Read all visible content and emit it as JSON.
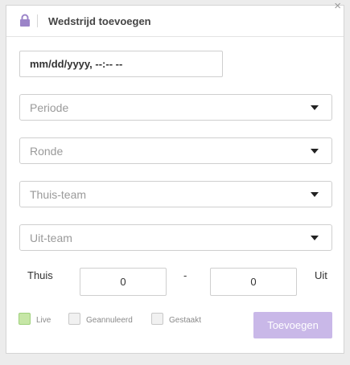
{
  "dialog": {
    "title": "Wedstrijd toevoegen",
    "close_symbol": "×",
    "icon": "lock-icon"
  },
  "form": {
    "datetime_placeholder": "mm/dd/yyyy, --:-- --",
    "periode_placeholder": "Periode",
    "ronde_placeholder": "Ronde",
    "thuis_team_placeholder": "Thuis-team",
    "uit_team_placeholder": "Uit-team",
    "home_label": "Thuis",
    "home_score": "0",
    "separator": "-",
    "away_score": "0",
    "away_label": "Uit",
    "checkboxes": [
      {
        "label": "Live",
        "checked": false,
        "color": "#c6e6a6"
      },
      {
        "label": "Geannuleerd",
        "checked": false
      },
      {
        "label": "Gestaakt",
        "checked": false
      }
    ],
    "submit_label": "Toevoegen"
  },
  "colors": {
    "accent": "#c9b8e8",
    "lock_icon": "#9b84c8"
  }
}
